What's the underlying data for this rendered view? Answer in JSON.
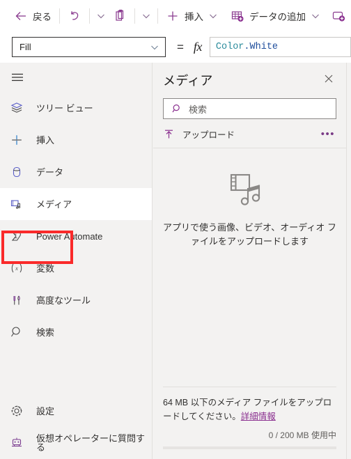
{
  "toolbar": {
    "back_label": "戻る",
    "back_icon": "arrow-left-icon",
    "undo_icon": "undo-icon",
    "undo_caret_icon": "chevron-down-icon",
    "paste_icon": "clipboard-paste-icon",
    "paste_caret_icon": "chevron-down-icon",
    "insert_icon": "plus-icon",
    "insert_label": "挿入",
    "insert_caret_icon": "chevron-down-icon",
    "add_data_icon": "add-data-table-icon",
    "add_data_label": "データの追加",
    "add_data_caret_icon": "chevron-down-icon",
    "new_screen_icon": "new-screen-icon"
  },
  "formula_bar": {
    "property": "Fill",
    "property_caret_icon": "chevron-down-icon",
    "equals": "=",
    "fx_label": "fx",
    "formula_object": "Color",
    "formula_property": ".White"
  },
  "sidebar": {
    "menu_icon": "hamburger-menu-icon",
    "items": [
      {
        "label": "ツリー ビュー",
        "icon": "tree-view-icon",
        "selected": false
      },
      {
        "label": "挿入",
        "icon": "plus-icon",
        "selected": false
      },
      {
        "label": "データ",
        "icon": "database-icon",
        "selected": false
      },
      {
        "label": "メディア",
        "icon": "media-icon",
        "selected": true
      },
      {
        "label": "Power Automate",
        "icon": "power-automate-icon",
        "selected": false
      },
      {
        "label": "変数",
        "icon": "variables-icon",
        "selected": false
      },
      {
        "label": "高度なツール",
        "icon": "advanced-tools-icon",
        "selected": false
      },
      {
        "label": "検索",
        "icon": "search-icon",
        "selected": false
      }
    ],
    "bottom_items": [
      {
        "label": "設定",
        "icon": "gear-icon"
      },
      {
        "label": "仮想オペレーターに質問する",
        "icon": "robot-icon"
      }
    ],
    "highlight_color": "#fa2a2a"
  },
  "media_panel": {
    "title": "メディア",
    "close_icon": "close-icon",
    "search_placeholder": "検索",
    "search_icon": "search-icon",
    "search_value": "",
    "upload_label": "アップロード",
    "upload_icon": "upload-icon",
    "overflow_icon": "more-options-icon",
    "empty_icon": "media-film-music-icon",
    "empty_message": "アプリで使う画像、ビデオ、オーディオ ファイルをアップロードします",
    "footer_note_1": "64 MB 以下のメディア ファイルをアップロードしてください。",
    "footer_link": "詳細情報",
    "usage_text": "0 / 200 MB 使用中",
    "usage_percent": 0,
    "accent_color": "#8a2f8f"
  }
}
